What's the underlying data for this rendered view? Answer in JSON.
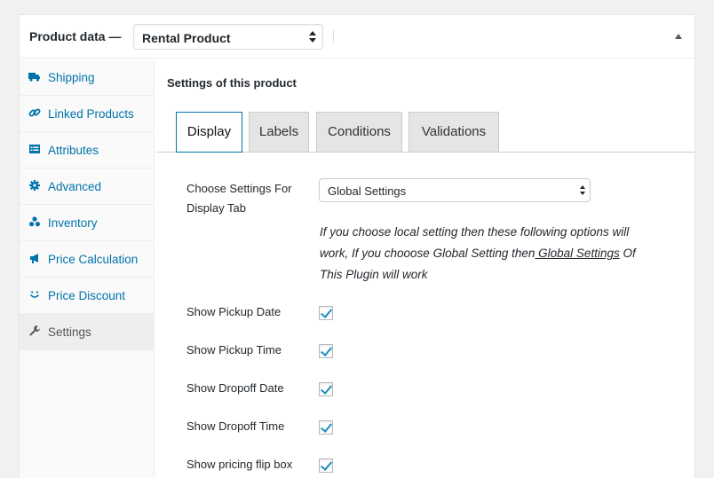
{
  "header": {
    "title": "Product data —",
    "product_type": "Rental Product"
  },
  "sidebar": {
    "items": [
      {
        "label": "Shipping",
        "icon": "truck-icon"
      },
      {
        "label": "Linked Products",
        "icon": "link-icon"
      },
      {
        "label": "Attributes",
        "icon": "list-icon"
      },
      {
        "label": "Advanced",
        "icon": "gear-icon"
      },
      {
        "label": "Inventory",
        "icon": "cubes-icon"
      },
      {
        "label": "Price Calculation",
        "icon": "megaphone-icon"
      },
      {
        "label": "Price Discount",
        "icon": "smiley-icon"
      },
      {
        "label": "Settings",
        "icon": "wrench-icon"
      }
    ]
  },
  "main": {
    "title": "Settings of this product",
    "tabs": [
      {
        "label": "Display"
      },
      {
        "label": "Labels"
      },
      {
        "label": "Conditions"
      },
      {
        "label": "Validations"
      }
    ],
    "choose_label": "Choose Settings For Display Tab",
    "choose_value": "Global Settings",
    "desc_text": "If you choose local setting then these following options will work, If you chooose Global Setting then",
    "desc_link": " Global Settings",
    "desc_tail": " Of This Plugin will work",
    "options": [
      {
        "label": "Show Pickup Date",
        "checked": true
      },
      {
        "label": "Show Pickup Time",
        "checked": true
      },
      {
        "label": "Show Dropoff Date",
        "checked": true
      },
      {
        "label": "Show Dropoff Time",
        "checked": true
      },
      {
        "label": "Show pricing flip box",
        "checked": true
      }
    ]
  },
  "colors": {
    "link": "#0073aa",
    "active_tab_border": "#0073aa",
    "checkmark": "#1e8cbe"
  }
}
